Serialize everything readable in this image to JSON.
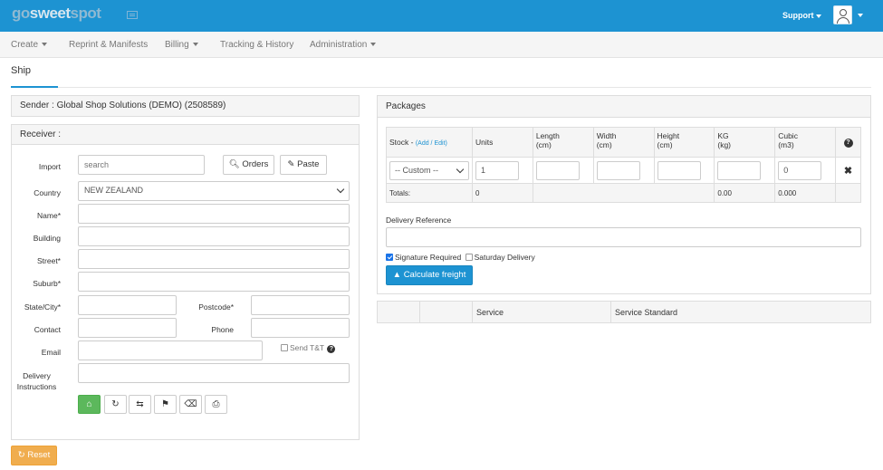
{
  "app": {
    "logo_part1": "go",
    "logo_part2": "sweet",
    "logo_part3": "spot",
    "support_label": "Support"
  },
  "nav": {
    "create": "Create",
    "reprint": "Reprint & Manifests",
    "billing": "Billing",
    "tracking": "Tracking & History",
    "administration": "Administration"
  },
  "page": {
    "tab": "Ship"
  },
  "sender": {
    "title": "Sender : Global Shop Solutions (DEMO) (2508589)"
  },
  "receiver": {
    "title": "Receiver :",
    "import_label": "Import",
    "import_placeholder": "search",
    "orders_button": "Orders",
    "paste_button": "Paste",
    "country_label": "Country",
    "country_value": "NEW ZEALAND",
    "name_label": "Name*",
    "building_label": "Building",
    "street_label": "Street*",
    "suburb_label": "Suburb*",
    "state_label": "State/City*",
    "postcode_label": "Postcode*",
    "contact_label": "Contact",
    "phone_label": "Phone",
    "email_label": "Email",
    "send_tt_label": "Send T&T",
    "delivery_label_1": "Delivery",
    "delivery_label_2": "Instructions"
  },
  "packages": {
    "title": "Packages",
    "headers": {
      "stock": "Stock -",
      "add_edit": "(Add / Edit)",
      "units": "Units",
      "length": "Length",
      "length_unit": "(cm)",
      "width": "Width",
      "width_unit": "(cm)",
      "height": "Height",
      "height_unit": "(cm)",
      "kg": "KG",
      "kg_unit": "(kg)",
      "cubic": "Cubic",
      "cubic_unit": "(m3)"
    },
    "row": {
      "stock_value": "-- Custom --",
      "units_value": "1",
      "length_value": "",
      "width_value": "",
      "height_value": "",
      "kg_value": "",
      "cubic_value": "0"
    },
    "totals": {
      "label": "Totals:",
      "units": "0",
      "kg": "0.00",
      "cubic": "0.000"
    },
    "delivery_reference_label": "Delivery Reference",
    "signature_label": "Signature Required",
    "signature_checked": true,
    "saturday_label": "Saturday Delivery",
    "saturday_checked": false,
    "calculate_button": "Calculate freight"
  },
  "services": {
    "service_header": "Service",
    "standard_header": "Service Standard"
  },
  "reset_button": "Reset",
  "colors": {
    "brand_blue": "#1d93d2",
    "success_green": "#5cb85c",
    "warning_orange": "#f0ad4e"
  }
}
